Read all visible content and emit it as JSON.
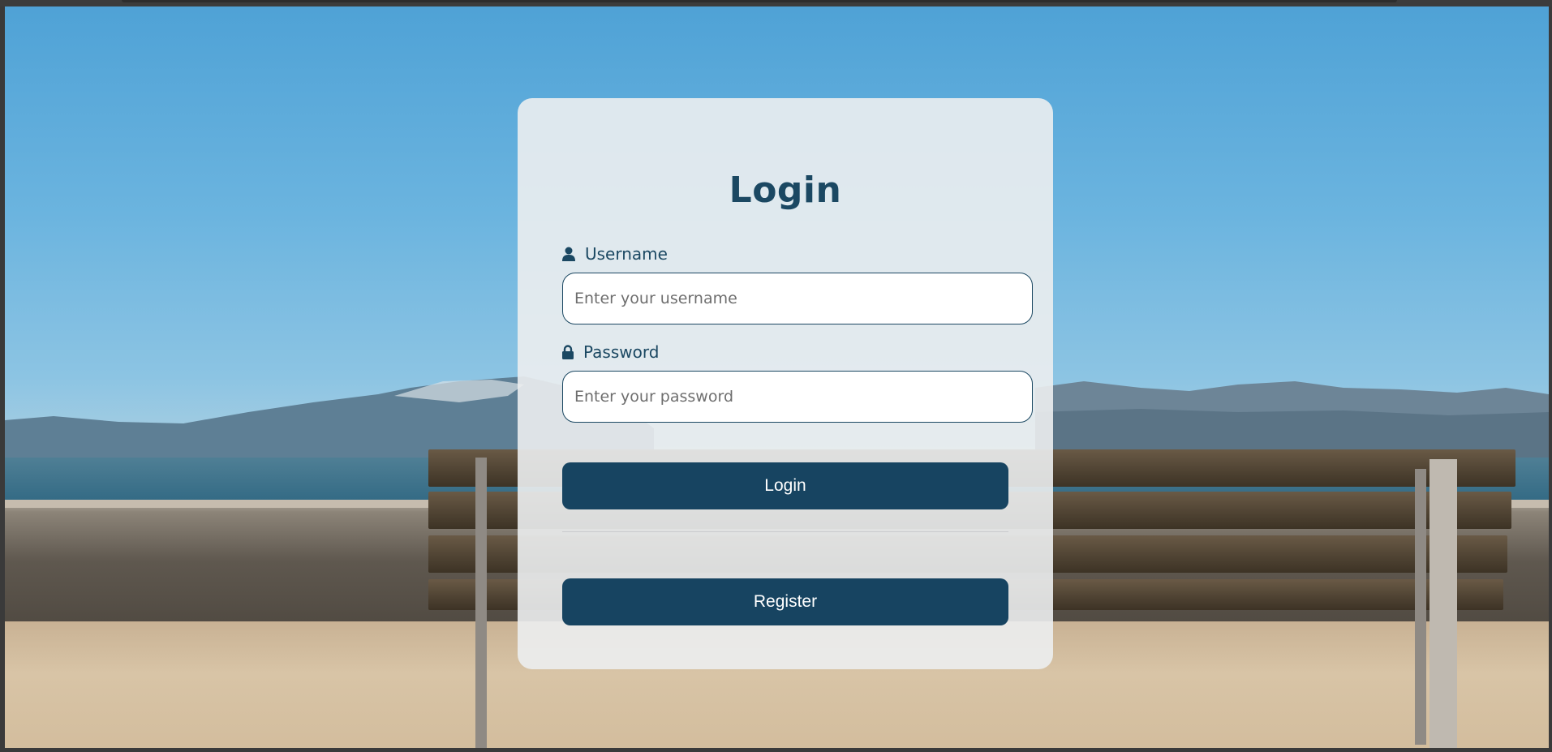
{
  "login_form": {
    "title": "Login",
    "username": {
      "label": "Username",
      "icon": "user-icon",
      "placeholder": "Enter your username",
      "value": ""
    },
    "password": {
      "label": "Password",
      "icon": "lock-icon",
      "placeholder": "Enter your password",
      "value": ""
    },
    "login_button_label": "Login",
    "register_button_label": "Register"
  },
  "colors": {
    "accent": "#174461",
    "title_text": "#1b4862",
    "card_background": "#eceef0",
    "input_border": "#1b4862"
  }
}
